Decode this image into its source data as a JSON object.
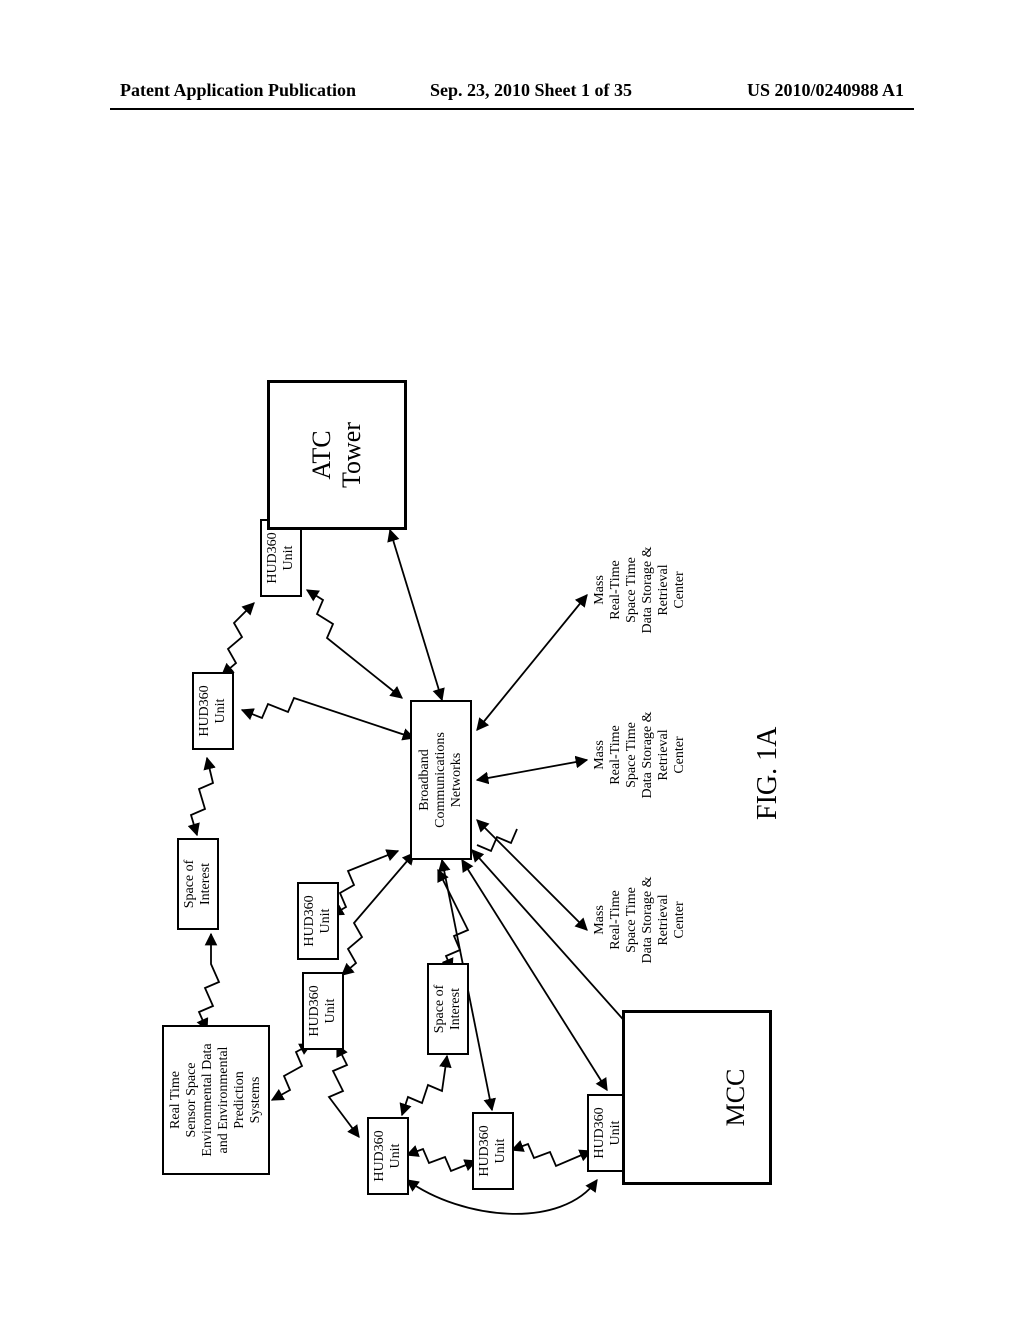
{
  "header": {
    "left": "Patent Application Publication",
    "center": "Sep. 23, 2010  Sheet 1 of 35",
    "right": "US 2010/0240988 A1"
  },
  "figure_label": "FIG. 1A",
  "nodes": {
    "rt_sensor": {
      "l1": "Real Time",
      "l2": "Sensor Space",
      "l3": "Environmental Data",
      "l4": "and Environmental",
      "l5": "Prediction",
      "l6": "Systems"
    },
    "space_of_interest_1": {
      "l1": "Space of",
      "l2": "Interest"
    },
    "space_of_interest_2": {
      "l1": "Space of",
      "l2": "Interest"
    },
    "hud360_a": {
      "l1": "HUD360",
      "l2": "Unit"
    },
    "hud360_b": {
      "l1": "HUD360",
      "l2": "Unit"
    },
    "hud360_c": {
      "l1": "HUD360",
      "l2": "Unit"
    },
    "hud360_d": {
      "l1": "HUD360",
      "l2": "Unit"
    },
    "hud360_e": {
      "l1": "HUD360",
      "l2": "Unit"
    },
    "hud360_mcc": {
      "l1": "HUD360",
      "l2": "Unit"
    },
    "hud360_atc": {
      "l1": "HUD360",
      "l2": "Unit"
    },
    "broadband": {
      "l1": "Broadband",
      "l2": "Communications",
      "l3": "Networks"
    },
    "mcc": "MCC",
    "atc": {
      "l1": "ATC",
      "l2": "Tower"
    },
    "mass1": {
      "l1": "Mass",
      "l2": "Real-Time",
      "l3": "Space Time",
      "l4": "Data Storage &",
      "l5": "Retrieval",
      "l6": "Center"
    },
    "mass2": {
      "l1": "Mass",
      "l2": "Real-Time",
      "l3": "Space Time",
      "l4": "Data Storage &",
      "l5": "Retrieval",
      "l6": "Center"
    },
    "mass3": {
      "l1": "Mass",
      "l2": "Real-Time",
      "l3": "Space Time",
      "l4": "Data Storage &",
      "l5": "Retrieval",
      "l6": "Center"
    }
  }
}
